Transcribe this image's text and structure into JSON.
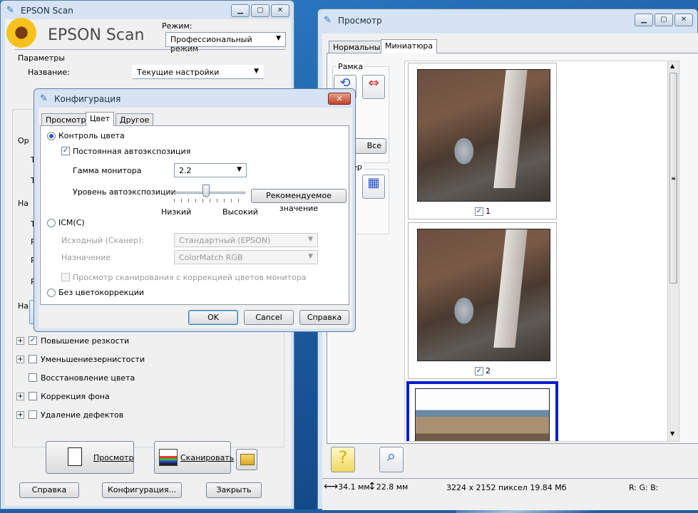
{
  "epson": {
    "title": "EPSON Scan",
    "logo": "EPSON Scan",
    "mode_label": "Режим:",
    "mode_value": "Профессиональный режим",
    "params_label": "Параметры",
    "name_label": "Название:",
    "name_value": "Текущие настройки",
    "side_letters": [
      "Ор",
      "Т",
      "Т",
      "На",
      "Т",
      "Р",
      "Р",
      "Р",
      "На"
    ],
    "options": [
      {
        "label": "Повышение резкости",
        "checked": true,
        "expand": true
      },
      {
        "label": "Уменьшениезернистости",
        "checked": false,
        "expand": true
      },
      {
        "label": "Восстановление цвета",
        "checked": false,
        "expand": false
      },
      {
        "label": "Коррекция фона",
        "checked": false,
        "expand": true
      },
      {
        "label": "Удаление дефектов",
        "checked": false,
        "expand": true
      }
    ],
    "preview_btn": "Просмотр",
    "scan_btn": "Сканировать",
    "help_btn": "Справка",
    "config_btn": "Конфигурация...",
    "close_btn": "Закрыть"
  },
  "config": {
    "title": "Конфигурация",
    "tabs": [
      "Просмотр",
      "Цвет",
      "Другое"
    ],
    "selected_tab": "Цвет",
    "color_control": "Контроль цвета",
    "auto_exposure": "Постоянная автоэкспозиция",
    "gamma_label": "Гамма монитора",
    "gamma_value": "2.2",
    "auto_level_label": "Уровень автоэкспозиции",
    "recommended_btn": "Рекомендуемое значение",
    "low_label": "Низкий",
    "high_label": "Высокий",
    "slider_level": 0.45,
    "icm_label": "ICM(C)",
    "source_label": "Исходный (Сканер):",
    "source_value": "Стандартный (EPSON)",
    "target_label": "Назначение",
    "target_value": "ColorMatch RGB",
    "preview_corr": "Просмотр сканирования с коррекцией цветов монитора",
    "no_corr": "Без цветокоррекции",
    "ok": "OK",
    "cancel": "Cancel",
    "help": "Справка"
  },
  "preview": {
    "title": "Просмотр",
    "tabs": [
      "Нормальный",
      "Миниатюра"
    ],
    "selected_tab": "Миниатюра",
    "frame_label": "Рамка",
    "all_btn": "Все",
    "group2_label": "ер",
    "thumbs": [
      {
        "label": "1",
        "checked": true
      },
      {
        "label": "2",
        "checked": true
      },
      {
        "label": "",
        "checked": false
      }
    ],
    "status_size": "34.1 мм",
    "status_height": "22.8 мм",
    "status_pixels": "3224 x 2152 пиксел 19.84 Мб",
    "status_rgb": "R: G: B:"
  },
  "icons": [
    "sunflower-logo",
    "question-icon",
    "zoom-icon",
    "folder-icon",
    "document-icon",
    "scanner-icon",
    "frame-icon",
    "frame-delete-icon",
    "grid-icon"
  ],
  "colors": {
    "titlebar": "#d6e3f2",
    "accent": "#1e3fd0",
    "selected_border": "#0b1fcf"
  }
}
